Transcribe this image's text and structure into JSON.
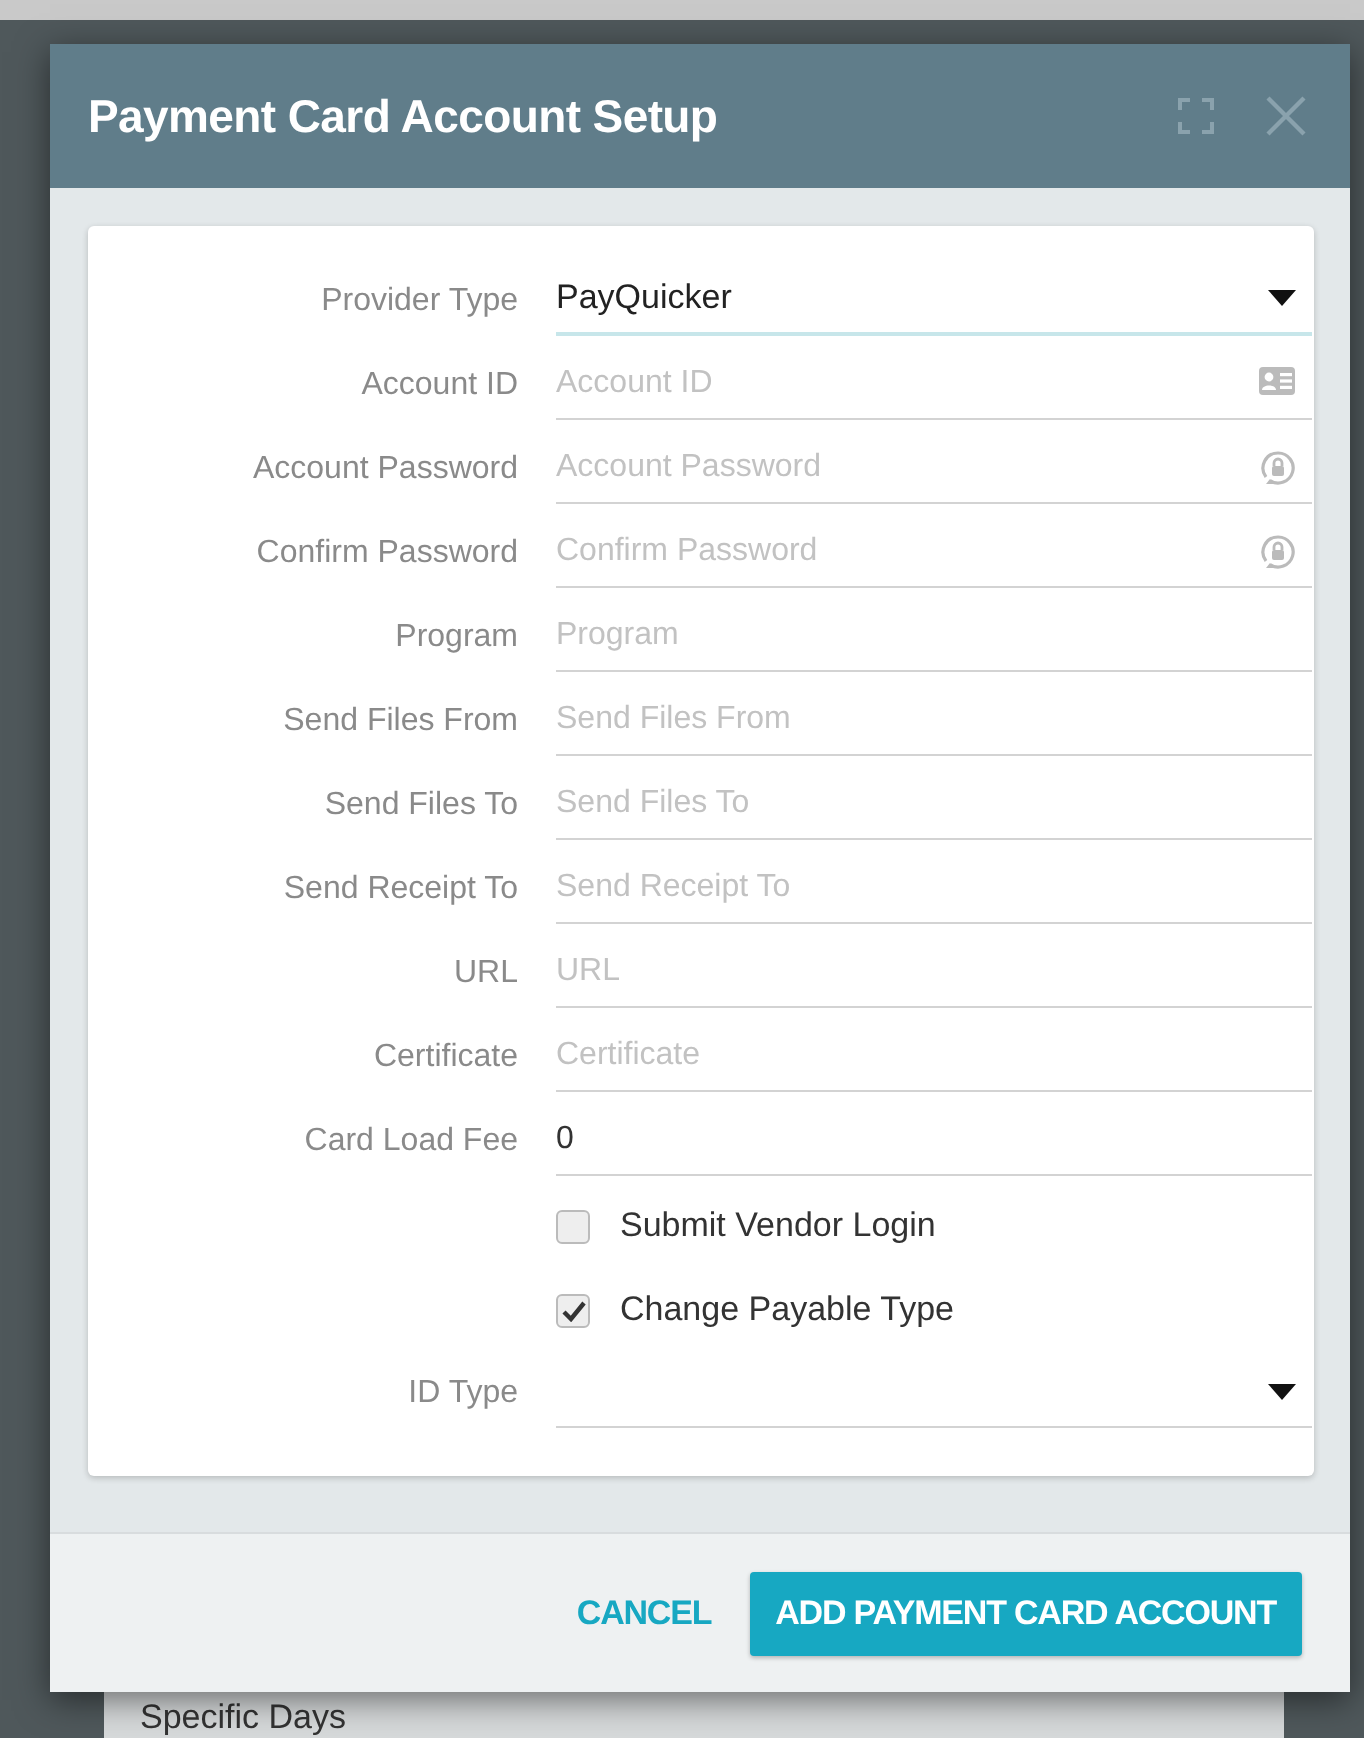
{
  "background": {
    "text": "Specific Days"
  },
  "dialog": {
    "title": "Payment Card Account Setup"
  },
  "fields": [
    {
      "kind": "select",
      "label": "Provider Type",
      "value": "PayQuicker",
      "focused": true
    },
    {
      "kind": "account",
      "label": "Account ID",
      "placeholder": "Account ID"
    },
    {
      "kind": "password",
      "label": "Account Password",
      "placeholder": "Account Password"
    },
    {
      "kind": "password",
      "label": "Confirm Password",
      "placeholder": "Confirm Password"
    },
    {
      "kind": "text",
      "label": "Program",
      "placeholder": "Program"
    },
    {
      "kind": "text",
      "label": "Send Files From",
      "placeholder": "Send Files From"
    },
    {
      "kind": "text",
      "label": "Send Files To",
      "placeholder": "Send Files To"
    },
    {
      "kind": "text",
      "label": "Send Receipt To",
      "placeholder": "Send Receipt To"
    },
    {
      "kind": "text",
      "label": "URL",
      "placeholder": "URL"
    },
    {
      "kind": "text",
      "label": "Certificate",
      "placeholder": "Certificate"
    },
    {
      "kind": "text",
      "label": "Card Load Fee",
      "value": "0"
    },
    {
      "kind": "checkbox",
      "label": "Submit Vendor Login",
      "checked": false
    },
    {
      "kind": "checkbox",
      "label": "Change Payable Type",
      "checked": true
    },
    {
      "kind": "select",
      "label": "ID Type",
      "focused": false
    }
  ],
  "buttons": [
    {
      "kind": "flat",
      "label": "CANCEL"
    },
    {
      "kind": "raised",
      "label": "ADD PAYMENT CARD ACCOUNT"
    }
  ]
}
